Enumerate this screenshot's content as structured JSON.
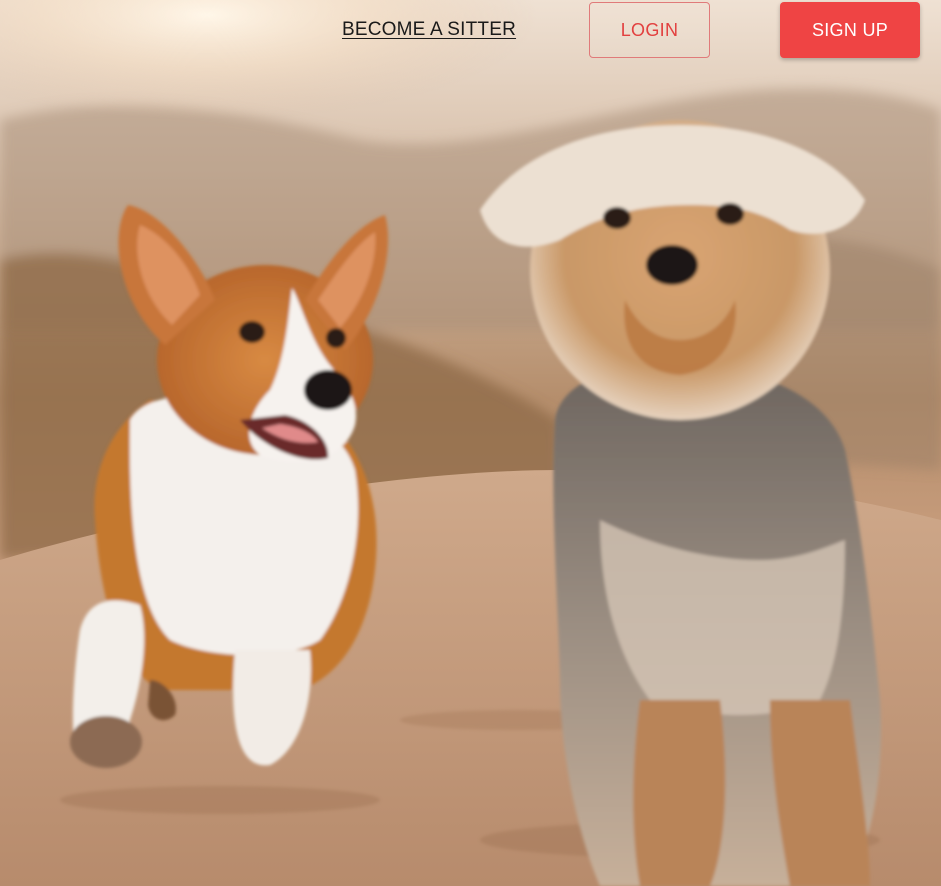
{
  "nav": {
    "become_sitter_label": "BECOME A SITTER",
    "login_label": "LOGIN",
    "signup_label": "SIGN UP"
  },
  "hero": {
    "image_icon": "hero-photo-two-dogs-running"
  },
  "colors": {
    "accent": "#ef4444",
    "login_text": "#e2403f",
    "login_border": "#e07a7a",
    "link_text": "#1a1a1a"
  }
}
